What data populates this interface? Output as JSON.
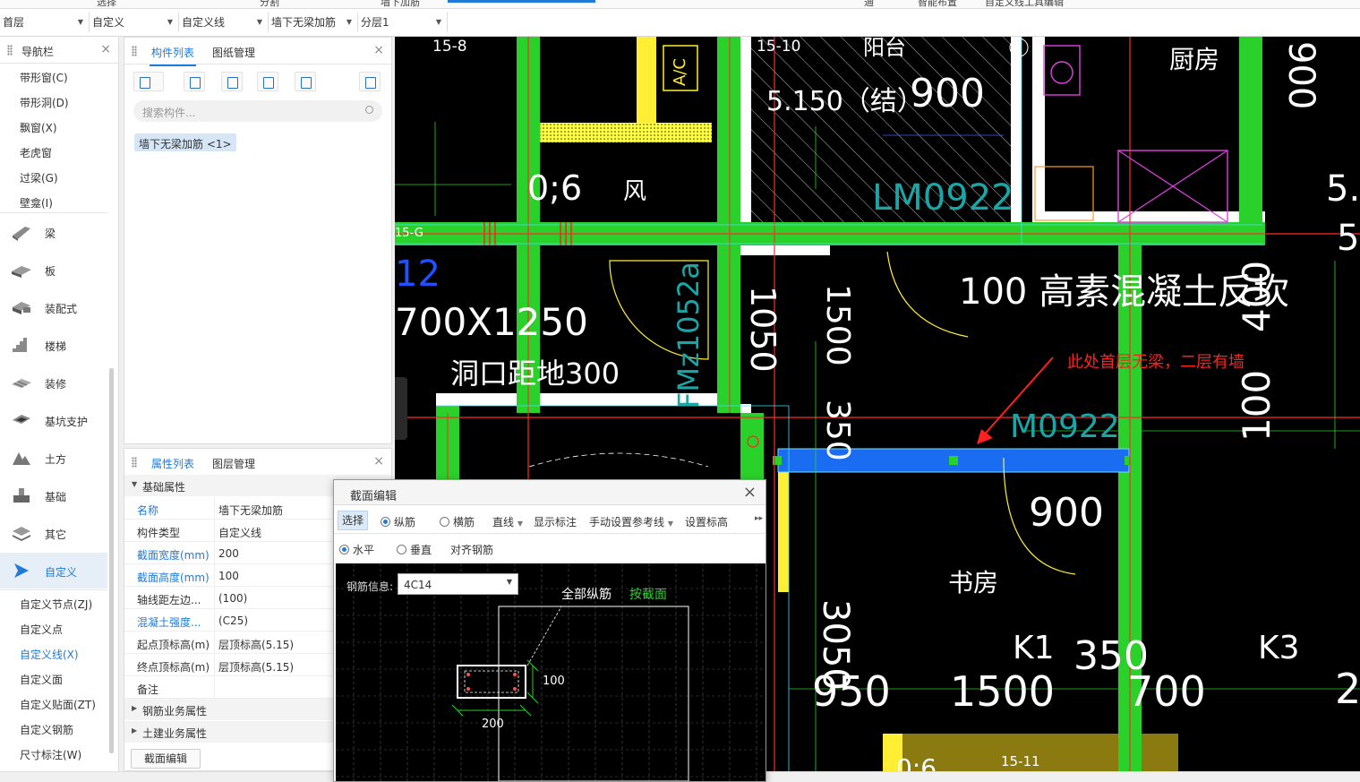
{
  "topbar": {
    "partial_items": [
      "选择",
      "分割",
      "墙下加筋",
      "",
      "",
      "通",
      "智能布置",
      "自定义线工具编辑"
    ]
  },
  "toolbar": {
    "floor": "首层",
    "category": "自定义",
    "type": "自定义线",
    "component": "墙下无梁加筋",
    "layer": "分层1"
  },
  "nav": {
    "title": "导航栏",
    "top_items": [
      "带形窗(C)",
      "带形洞(D)",
      "飘窗(X)",
      "老虎窗",
      "过梁(G)",
      "壁龛(I)"
    ],
    "categories": [
      "梁",
      "板",
      "装配式",
      "楼梯",
      "装修",
      "基坑支护",
      "土方",
      "基础",
      "其它",
      "自定义"
    ],
    "active_category": "自定义",
    "sub_items": [
      "自定义节点(ZJ)",
      "自定义点",
      "自定义线(X)",
      "自定义面",
      "自定义贴面(ZT)",
      "自定义钢筋",
      "尺寸标注(W)"
    ],
    "active_sub": "自定义线(X)"
  },
  "component_list": {
    "tab_active": "构件列表",
    "tab_other": "图纸管理",
    "search_placeholder": "搜索构件...",
    "item": "墙下无梁加筋 <1>"
  },
  "properties": {
    "tab_active": "属性列表",
    "tab_other": "图层管理",
    "section_basic": "基础属性",
    "rows": [
      {
        "key": "名称",
        "value": "墙下无梁加筋",
        "blue": true
      },
      {
        "key": "构件类型",
        "value": "自定义线",
        "blue": false
      },
      {
        "key": "截面宽度(mm)",
        "value": "200",
        "blue": true
      },
      {
        "key": "截面高度(mm)",
        "value": "100",
        "blue": true
      },
      {
        "key": "轴线距左边...",
        "value": "(100)",
        "blue": false
      },
      {
        "key": "混凝土强度...",
        "value": "(C25)",
        "blue": true
      },
      {
        "key": "起点顶标高(m)",
        "value": "层顶标高(5.15)",
        "blue": false
      },
      {
        "key": "终点顶标高(m)",
        "value": "层顶标高(5.15)",
        "blue": false
      },
      {
        "key": "备注",
        "value": "",
        "blue": false
      }
    ],
    "section_rebar": "钢筋业务属性",
    "section_civil": "土建业务属性",
    "edit_button": "截面编辑"
  },
  "dialog": {
    "title": "截面编辑",
    "select": "选择",
    "longitudinal": "纵筋",
    "transverse": "横筋",
    "line": "直线",
    "show_annot": "显示标注",
    "manual_ref": "手动设置参考线",
    "set_elev": "设置标高",
    "horizontal": "水平",
    "vertical": "垂直",
    "align": "对齐钢筋",
    "rebar_label": "钢筋信息:",
    "rebar_value": "4C14",
    "all_long": "全部纵筋",
    "by_section": "按截面",
    "dim_h": "100",
    "dim_w": "200"
  },
  "canvas": {
    "annotation": "此处首层无梁，二层有墙",
    "texts": [
      "15-8",
      "15-10",
      "阳台",
      "厨房",
      "5.150（结）",
      "900",
      "0;6",
      "风",
      "LM0922",
      "15-G",
      "12",
      "700X1250",
      "洞口距地300",
      "FMz1052a",
      "1050",
      "1500",
      "350",
      "100 高素混凝土反坎",
      "400",
      "100",
      "M0922",
      "900",
      "书房",
      "3050",
      "950",
      "1500",
      "700",
      "350",
      "K1",
      "K3",
      "15-11",
      "0;6",
      "A/C",
      "900",
      "5.",
      "5.",
      "2"
    ]
  },
  "colors": {
    "accent": "#1f7ad8",
    "wall_green": "#2bd12b",
    "selected_blue": "#1a6cf0",
    "annotation_red": "#ff2020"
  }
}
